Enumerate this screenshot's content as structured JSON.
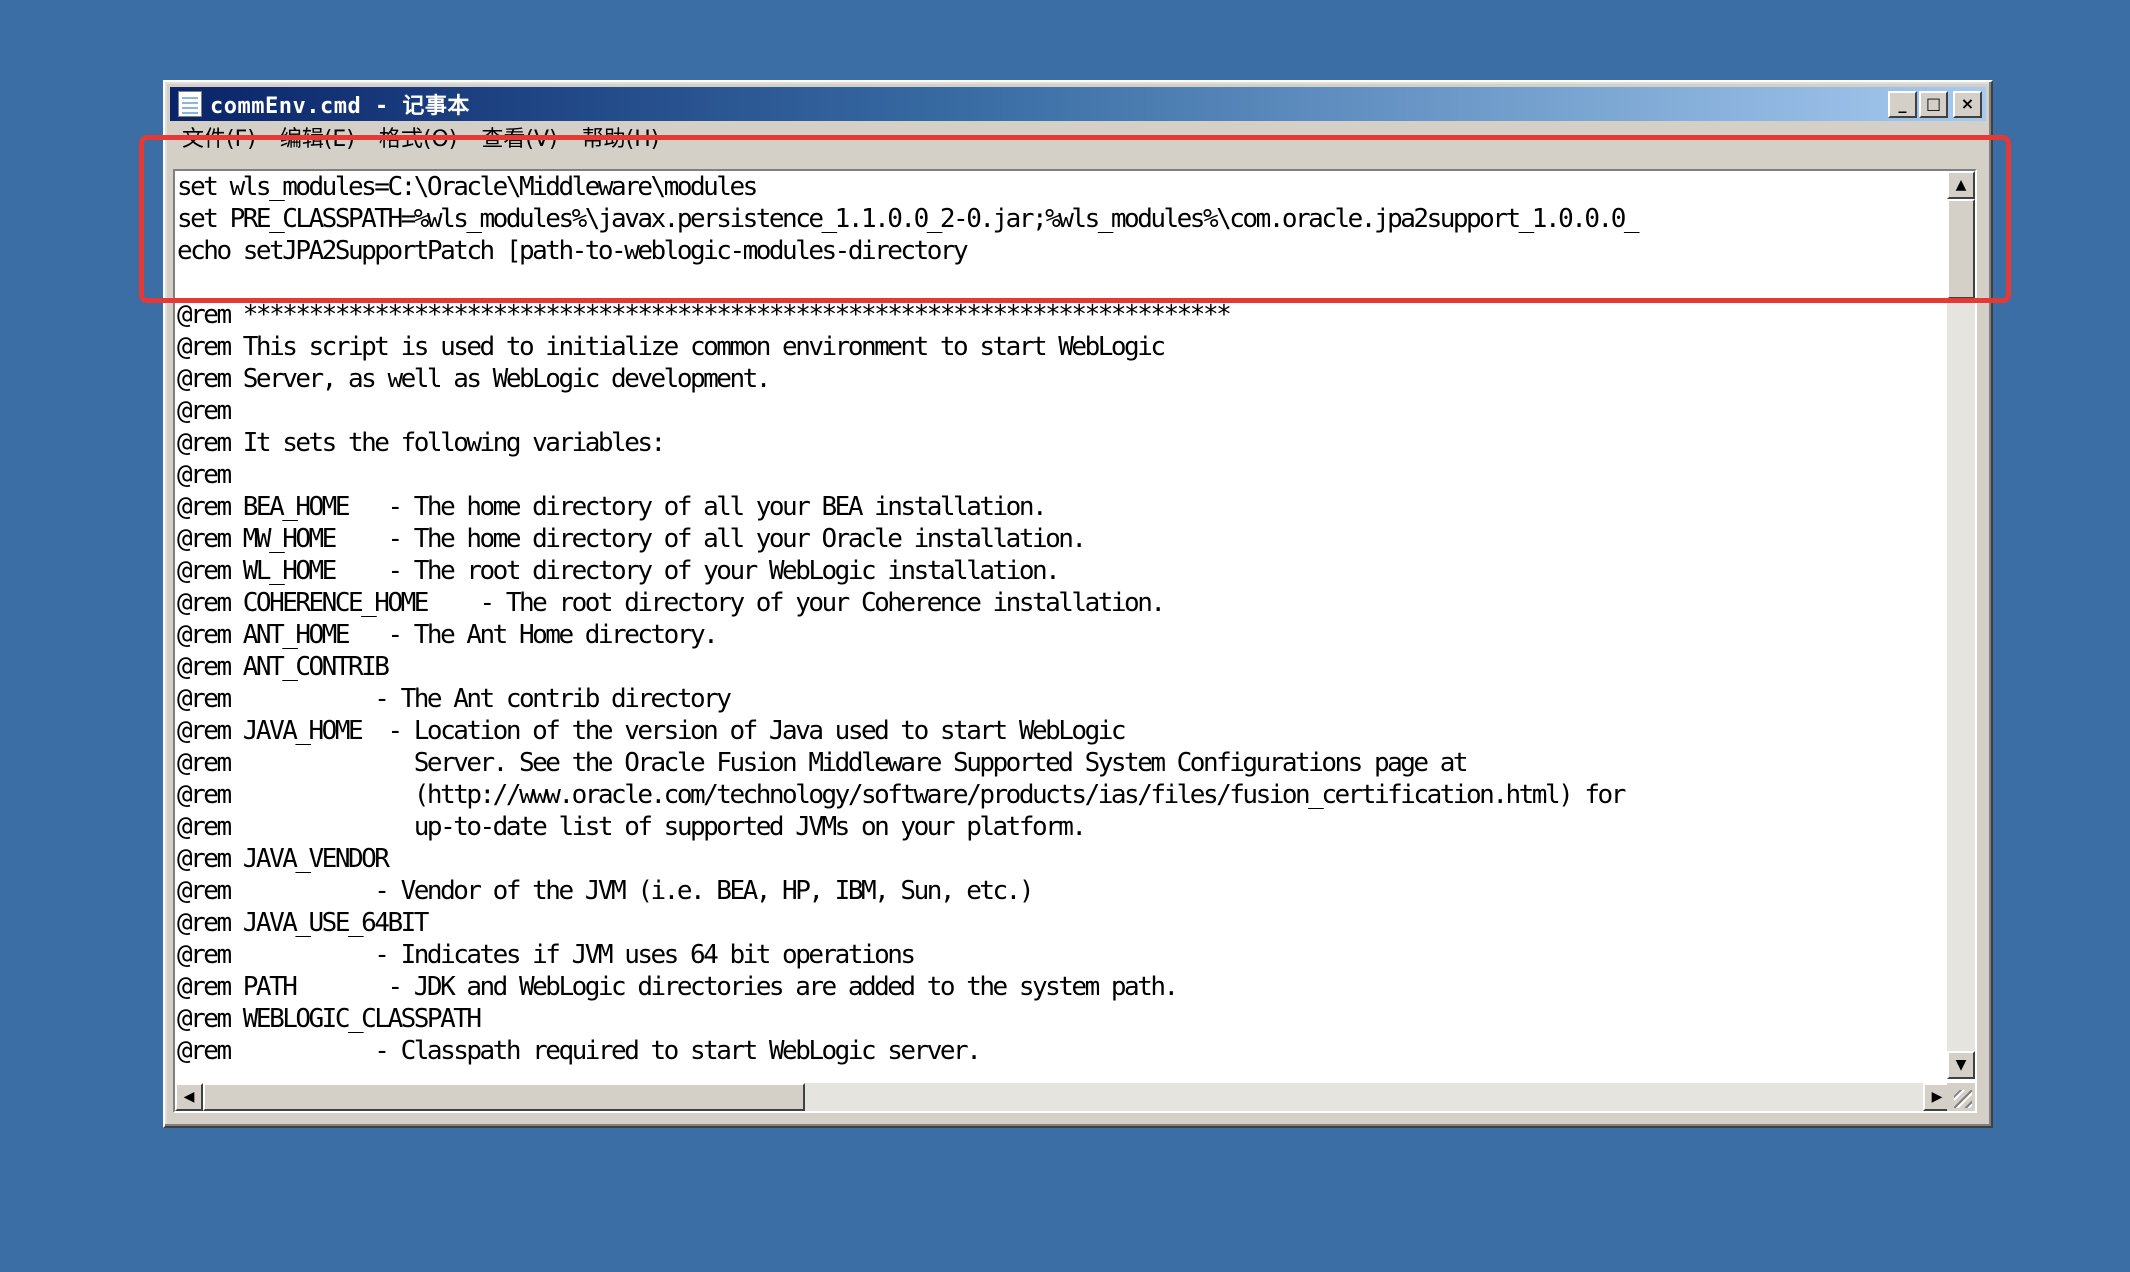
{
  "window": {
    "title": "commEnv.cmd - 记事本",
    "minimize_glyph": "_",
    "maximize_glyph": "□",
    "close_glyph": "×"
  },
  "menu": [
    {
      "label": "文件(F)"
    },
    {
      "label": "编辑(E)"
    },
    {
      "label": "格式(O)"
    },
    {
      "label": "查看(V)"
    },
    {
      "label": "帮助(H)"
    }
  ],
  "editor": {
    "lines": [
      "set wls_modules=C:\\Oracle\\Middleware\\modules",
      "set PRE_CLASSPATH=%wls_modules%\\javax.persistence_1.1.0.0_2-0.jar;%wls_modules%\\com.oracle.jpa2support_1.0.0.0_",
      "echo setJPA2SupportPatch [path-to-weblogic-modules-directory",
      "",
      "@rem ***************************************************************************",
      "@rem This script is used to initialize common environment to start WebLogic",
      "@rem Server, as well as WebLogic development.",
      "@rem",
      "@rem It sets the following variables:",
      "@rem",
      "@rem BEA_HOME   - The home directory of all your BEA installation.",
      "@rem MW_HOME    - The home directory of all your Oracle installation.",
      "@rem WL_HOME    - The root directory of your WebLogic installation.",
      "@rem COHERENCE_HOME    - The root directory of your Coherence installation.",
      "@rem ANT_HOME   - The Ant Home directory.",
      "@rem ANT_CONTRIB",
      "@rem           - The Ant contrib directory",
      "@rem JAVA_HOME  - Location of the version of Java used to start WebLogic",
      "@rem              Server. See the Oracle Fusion Middleware Supported System Configurations page at",
      "@rem              (http://www.oracle.com/technology/software/products/ias/files/fusion_certification.html) for",
      "@rem              up-to-date list of supported JVMs on your platform.",
      "@rem JAVA_VENDOR",
      "@rem           - Vendor of the JVM (i.e. BEA, HP, IBM, Sun, etc.)",
      "@rem JAVA_USE_64BIT",
      "@rem           - Indicates if JVM uses 64 bit operations",
      "@rem PATH       - JDK and WebLogic directories are added to the system path.",
      "@rem WEBLOGIC_CLASSPATH",
      "@rem           - Classpath required to start WebLogic server."
    ]
  },
  "scrollbars": {
    "up_glyph": "▲",
    "down_glyph": "▼",
    "left_glyph": "◀",
    "right_glyph": "▶"
  },
  "colors": {
    "desktop": "#3a6ea5",
    "highlight": "#e53935"
  }
}
